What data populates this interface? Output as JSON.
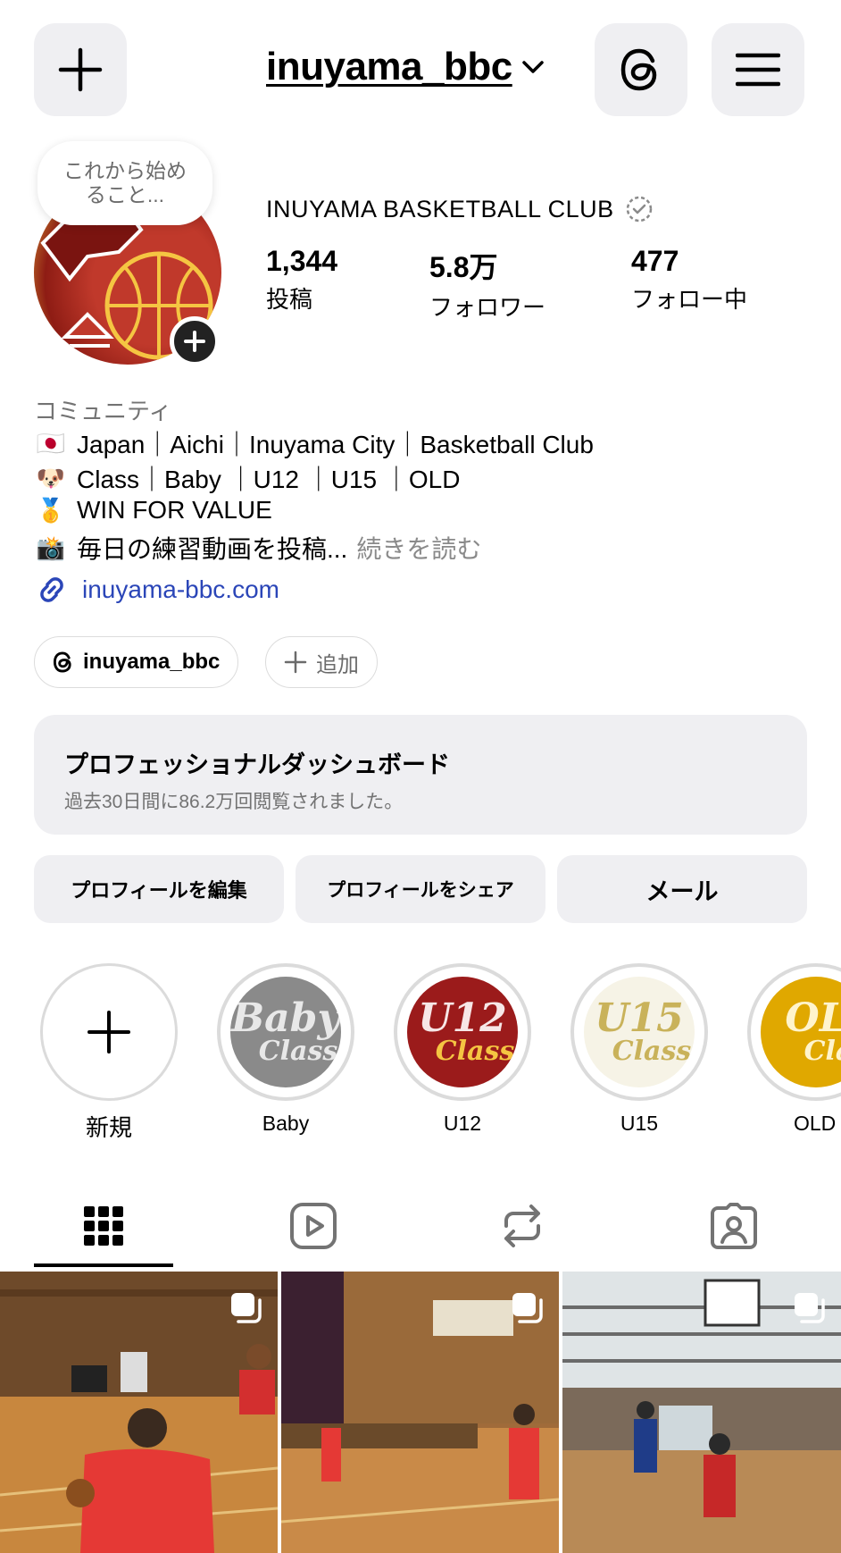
{
  "header": {
    "username": "inuyama_bbc"
  },
  "profile": {
    "note": "これから始めること...",
    "full_name": "INUYAMA BASKETBALL CLUB",
    "stats": [
      {
        "value": "1,344",
        "label": "投稿"
      },
      {
        "value": "5.8万",
        "label": "フォロワー"
      },
      {
        "value": "477",
        "label": "フォロー中"
      }
    ],
    "category": "コミュニティ",
    "bio": [
      {
        "emoji": "🇯🇵",
        "text": "Japan｜Aichi｜Inuyama City｜Basketball Club"
      },
      {
        "emoji": "🐶",
        "text": "Class｜Baby ｜U12 ｜U15 ｜OLD"
      },
      {
        "emoji": "🥇",
        "text": "WIN FOR VALUE"
      },
      {
        "emoji": "📸",
        "text": "毎日の練習動画を投稿..."
      }
    ],
    "more_label": "続きを読む",
    "link": "inuyama-bbc.com"
  },
  "chips": {
    "threads": "inuyama_bbc",
    "add": "追加"
  },
  "dashboard": {
    "title": "プロフェッショナルダッシュボード",
    "subtitle": "過去30日間に86.2万回閲覧されました。"
  },
  "actions": {
    "edit": "プロフィールを編集",
    "share": "プロフィールをシェア",
    "mail": "メール"
  },
  "highlights": [
    {
      "label": "新規"
    },
    {
      "label": "Baby",
      "cover_big": "Baby",
      "cover_small": "Class",
      "color": "#8a8a8a"
    },
    {
      "label": "U12",
      "cover_big": "U12",
      "cover_small": "Class",
      "color": "#9b1b1b"
    },
    {
      "label": "U15",
      "cover_big": "U15",
      "cover_small": "Class",
      "color": "#f6f3e6"
    },
    {
      "label": "OLD",
      "cover_big": "OL",
      "cover_small": "Cla",
      "color": "#e0a800"
    }
  ],
  "tabs": [
    "grid-icon",
    "reels-icon",
    "reposts-icon",
    "tagged-icon"
  ],
  "colors": {
    "button_bg": "#efeff2",
    "link": "#2b46b8",
    "secondary_text": "#737373"
  }
}
